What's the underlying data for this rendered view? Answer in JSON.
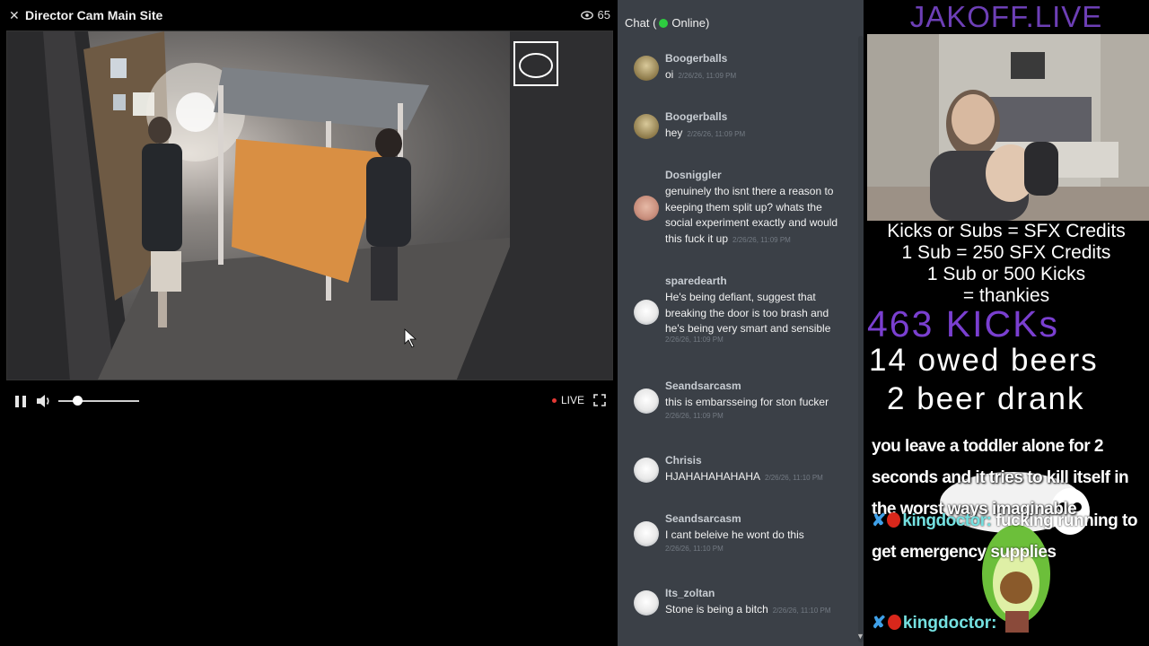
{
  "player": {
    "title": "Director Cam Main Site",
    "viewer_count": "65",
    "live_label": "LIVE",
    "volume_level": 0.25
  },
  "chat": {
    "header_prefix": "Chat (",
    "header_status": "Online)",
    "messages": [
      {
        "user": "Boogerballs",
        "text": "oi",
        "time": "2/26/26, 11:09 PM"
      },
      {
        "user": "Boogerballs",
        "text": "hey",
        "time": "2/26/26, 11:09 PM"
      },
      {
        "user": "Dosniggler",
        "text": "genuinely tho isnt there a reason to keeping them split up? whats the social experiment exactly and would this fuck it up",
        "time": "2/26/26, 11:09 PM"
      },
      {
        "user": "sparedearth",
        "text": "He's being defiant, suggest that breaking the door is too brash and he's being very smart and sensible",
        "time": "2/26/26, 11:09 PM"
      },
      {
        "user": "Seandsarcasm",
        "text": "this is embarsseing for ston fucker",
        "time": "2/26/26, 11:09 PM"
      },
      {
        "user": "Chrisis",
        "text": "HJAHAHAHAHAHA",
        "time": "2/26/26, 11:10 PM"
      },
      {
        "user": "Seandsarcasm",
        "text": "I cant beleive he wont do this",
        "time": "2/26/26, 11:10 PM"
      },
      {
        "user": "Its_zoltan",
        "text": "Stone is being a bitch",
        "time": "2/26/26, 11:10 PM"
      }
    ]
  },
  "overlay": {
    "brand": "JAKOFF.LIVE",
    "sfx_lines": [
      "Kicks or Subs = SFX Credits",
      "1 Sub = 250 SFX Credits",
      "1 Sub or 500 Kicks",
      "= thankies"
    ],
    "kicks": "463 KICKs",
    "owed_beers": "14 owed beers",
    "beer_drank": "2 beer drank",
    "alert_text": "you leave a toddler alone for 2 seconds and it tries to kill itself in the worst ways imaginable",
    "feed": [
      {
        "user": "kingdoctor:",
        "text": "fucking running to get emergency supplies"
      },
      {
        "user": "kingdoctor:",
        "text": ""
      }
    ]
  }
}
